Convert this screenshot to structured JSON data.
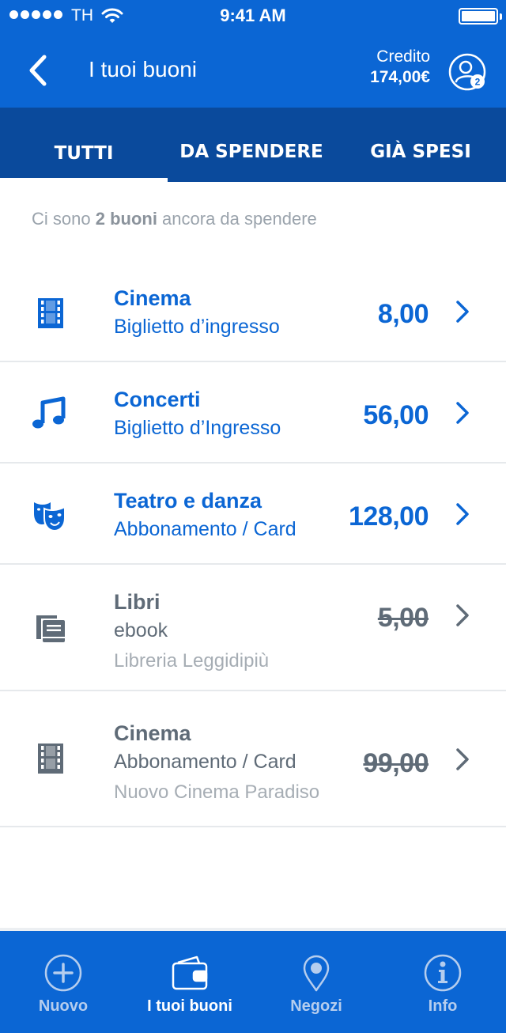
{
  "status_bar": {
    "carrier": "TH",
    "time": "9:41 AM"
  },
  "header": {
    "title": "I tuoi buoni",
    "credit_label": "Credito",
    "credit_value": "174,00€",
    "profile_badge": "2"
  },
  "tabs": [
    {
      "label": "TUTTI",
      "active": true
    },
    {
      "label": "DA SPENDERE",
      "active": false
    },
    {
      "label": "GIÀ SPESI",
      "active": false
    }
  ],
  "intro": {
    "prefix": "Ci sono ",
    "highlight": "2 buoni",
    "suffix": " ancora da spendere"
  },
  "vouchers": [
    {
      "category": "Cinema",
      "type": "Biglietto d’ingresso",
      "amount": "8,00",
      "icon": "film-icon",
      "spent": false
    },
    {
      "category": "Concerti",
      "type": "Biglietto d’Ingresso",
      "amount": "56,00",
      "icon": "music-note-icon",
      "spent": false
    },
    {
      "category": "Teatro e danza",
      "type": "Abbonamento / Card",
      "amount": "128,00",
      "icon": "theater-masks-icon",
      "spent": false
    },
    {
      "category": "Libri",
      "type": "ebook",
      "shop": "Libreria Leggidipiù",
      "amount": "5,00",
      "icon": "books-icon",
      "spent": true
    },
    {
      "category": "Cinema",
      "type": "Abbonamento / Card",
      "shop": "Nuovo Cinema Paradiso",
      "amount": "99,00",
      "icon": "film-icon",
      "spent": true
    }
  ],
  "bottom_nav": [
    {
      "label": "Nuovo",
      "icon": "plus-circle-icon",
      "active": false
    },
    {
      "label": "I tuoi buoni",
      "icon": "wallet-icon",
      "active": true
    },
    {
      "label": "Negozi",
      "icon": "map-pin-icon",
      "active": false
    },
    {
      "label": "Info",
      "icon": "info-icon",
      "active": false
    }
  ],
  "colors": {
    "primary": "#0b66d4",
    "tabs_bg": "#0a4a9c",
    "spent_grey": "#5f6b77"
  }
}
